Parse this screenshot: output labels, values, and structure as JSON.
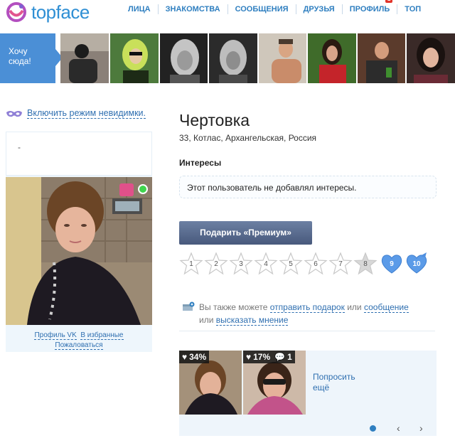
{
  "header": {
    "logo_text": "topface",
    "nav": [
      {
        "label": "ЛИЦА"
      },
      {
        "label": "ЗНАКОМСТВА"
      },
      {
        "label": "СООБЩЕНИЯ"
      },
      {
        "label": "ДРУЗЬЯ"
      },
      {
        "label": "ПРОФИЛЬ",
        "badge": "1"
      },
      {
        "label": "ТОП"
      }
    ]
  },
  "strip": {
    "cta_line1": "Хочу",
    "cta_line2": "сюда!"
  },
  "left": {
    "invisible_label": "Включить режим невидимки.",
    "card_dash": "-",
    "profile_vk": "Профиль VK",
    "to_favorites": "В избранные",
    "complain": "Пожаловаться"
  },
  "profile": {
    "name": "Чертовка",
    "location": "33,  Котлас, Архангельская, Россия",
    "interests_title": "Интересы",
    "interests_text": "Этот пользователь не добавлял интересы.",
    "premium_button": "Подарить «Премиум»"
  },
  "rating": {
    "stars": [
      "1",
      "2",
      "3",
      "4",
      "5",
      "6",
      "7",
      "8"
    ],
    "hearts": [
      "9",
      "10"
    ]
  },
  "gift": {
    "prefix": "Вы также можете",
    "send_gift": "отправить подарок",
    "or1": "или",
    "message": "сообщение",
    "or2": "или",
    "opinion": "высказать мнение"
  },
  "carousel": {
    "photo1_stat": "34%",
    "photo2_stat": "17%",
    "photo2_comments": "1",
    "ask_more_line1": "Попросить",
    "ask_more_line2": "ещё"
  },
  "colors": {
    "accent": "#2f7fc0",
    "online": "#3fd54d",
    "heart": "#e0508a"
  }
}
